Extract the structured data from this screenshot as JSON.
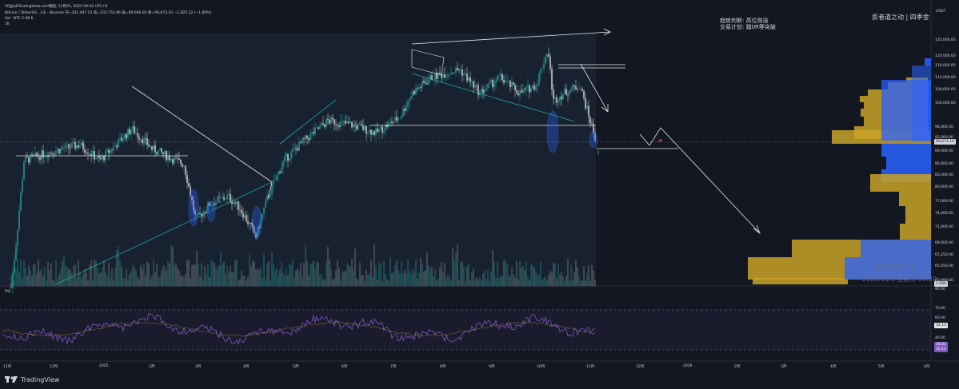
{
  "header": {
    "line1": "SOJJ/p&TradingView.com制图, 11月05, 2025 09:20 UTC+8",
    "line2": "Bitcoin / TetherUS · 1天 · Binance  开=101,497.23  高=101,752.96  低=99,666.00  收=99,673.10  −1,825.12 (−1.80%)",
    "line3": "Vol · BTC  2.08 K",
    "line4": "1K",
    "currency": "USDT"
  },
  "annotations": {
    "trend_label": "趋势判断:",
    "trend_value": "高位滁涨",
    "plan_label": "交易计划:",
    "plan_value": "踏0R等突破",
    "author": "反者道之动 | 四季金"
  },
  "watermark": {
    "symbol": "BTCUSDT · D",
    "datetime": "2025/11/5 星期三 09:20"
  },
  "price_axis": [
    "125,000.00",
    "120,000.00",
    "116,000.00",
    "112,000.00",
    "108,000.00",
    "104,000.00",
    "96,000.00",
    "92,000.00",
    "89,000.00",
    "86,000.00",
    "83,000.00",
    "80,000.00",
    "77,000.00",
    "74,000.00",
    "71,000.00",
    "69,000.00",
    "67,250.00",
    "65,450.00",
    "63,000.00"
  ],
  "current_price_tag": "99,673.10",
  "volume_tag": "2.08K",
  "rsi": {
    "label": "RSI",
    "axis": [
      "90.00",
      "70.00",
      "60.00",
      "50.00",
      "40.00",
      "30.00"
    ],
    "value_tag_1": "34.13",
    "value_tag_2": "28.01",
    "value_tag_3": "30.11"
  },
  "time_axis": [
    "11月",
    "12月",
    "2025",
    "2月",
    "3月",
    "4月",
    "5月",
    "6月",
    "7月",
    "8月",
    "9月",
    "10月",
    "11月",
    "12月",
    "2026",
    "2月",
    "3月",
    "4月",
    "5月",
    "6月"
  ],
  "footer": {
    "brand": "TradingView"
  },
  "colors": {
    "background": "#131722",
    "up": "#26a69a",
    "panel": "#1c2a3b",
    "profile_blue": "#2962ff",
    "profile_gold": "#c9a227",
    "rsi_line": "#7e57c2"
  },
  "chart_data": {
    "type": "line",
    "title": "",
    "x": [
      "11月",
      "12月",
      "2025",
      "2月",
      "3月",
      "4月",
      "5月",
      "6月",
      "7月",
      "8月",
      "9月",
      "10月",
      "11月"
    ],
    "series": [
      {
        "values": [
          69000,
          96000,
          94000,
          101000,
          86000,
          78000,
          96000,
          105000,
          117000,
          118000,
          112000,
          122000,
          99673
        ]
      }
    ],
    "ylim": [
      63000,
      127000
    ],
    "last_close": 99673.1
  }
}
